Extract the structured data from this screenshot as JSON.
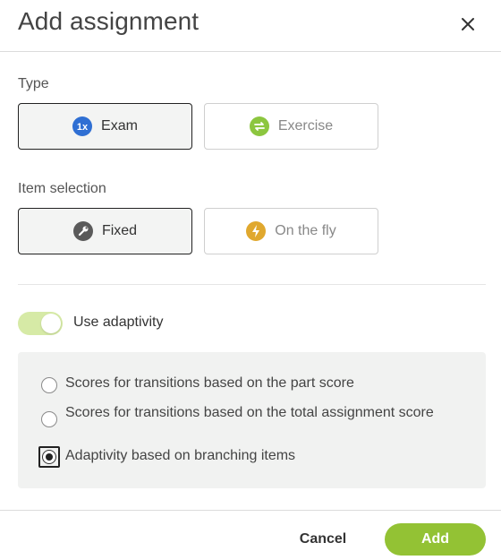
{
  "dialog": {
    "title": "Add assignment"
  },
  "type": {
    "label": "Type",
    "options": [
      {
        "label": "Exam",
        "icon": "one-x-icon",
        "icon_color": "#2f6fd3",
        "selected": true
      },
      {
        "label": "Exercise",
        "icon": "repeat-icon",
        "icon_color": "#8cc63f",
        "selected": false
      }
    ]
  },
  "item_selection": {
    "label": "Item selection",
    "options": [
      {
        "label": "Fixed",
        "icon": "wrench-icon",
        "icon_color": "#555555",
        "selected": true
      },
      {
        "label": "On the fly",
        "icon": "lightning-icon",
        "icon_color": "#e0a82e",
        "selected": false
      }
    ]
  },
  "adaptivity": {
    "toggle_label": "Use adaptivity",
    "enabled": true,
    "options": [
      {
        "label": "Scores for transitions based on the part score",
        "selected": false
      },
      {
        "label": "Scores for transitions based on the total assignment score",
        "selected": false
      },
      {
        "label": "Adaptivity based on branching items",
        "selected": true
      }
    ]
  },
  "footer": {
    "cancel_label": "Cancel",
    "add_label": "Add"
  },
  "colors": {
    "accent": "#93c234",
    "toggle_track": "#d6eaa6"
  }
}
